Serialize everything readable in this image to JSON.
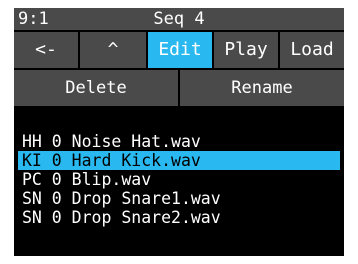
{
  "header": {
    "position": "9:1",
    "title": "Seq 4"
  },
  "tabs": [
    {
      "label": "<-",
      "active": false
    },
    {
      "label": "^",
      "active": false
    },
    {
      "label": "Edit",
      "active": true
    },
    {
      "label": "Play",
      "active": false
    },
    {
      "label": "Load",
      "active": false
    }
  ],
  "actions": {
    "delete_label": "Delete",
    "rename_label": "Rename"
  },
  "files": [
    {
      "label": "HH 0 Noise Hat.wav",
      "selected": false
    },
    {
      "label": "KI 0 Hard Kick.wav",
      "selected": true
    },
    {
      "label": "PC 0 Blip.wav",
      "selected": false
    },
    {
      "label": "SN 0 Drop Snare1.wav",
      "selected": false
    },
    {
      "label": "SN 0 Drop Snare2.wav",
      "selected": false
    }
  ],
  "colors": {
    "accent": "#29b9f0",
    "button_bg": "#4a4a4a",
    "screen_bg": "#000000"
  }
}
